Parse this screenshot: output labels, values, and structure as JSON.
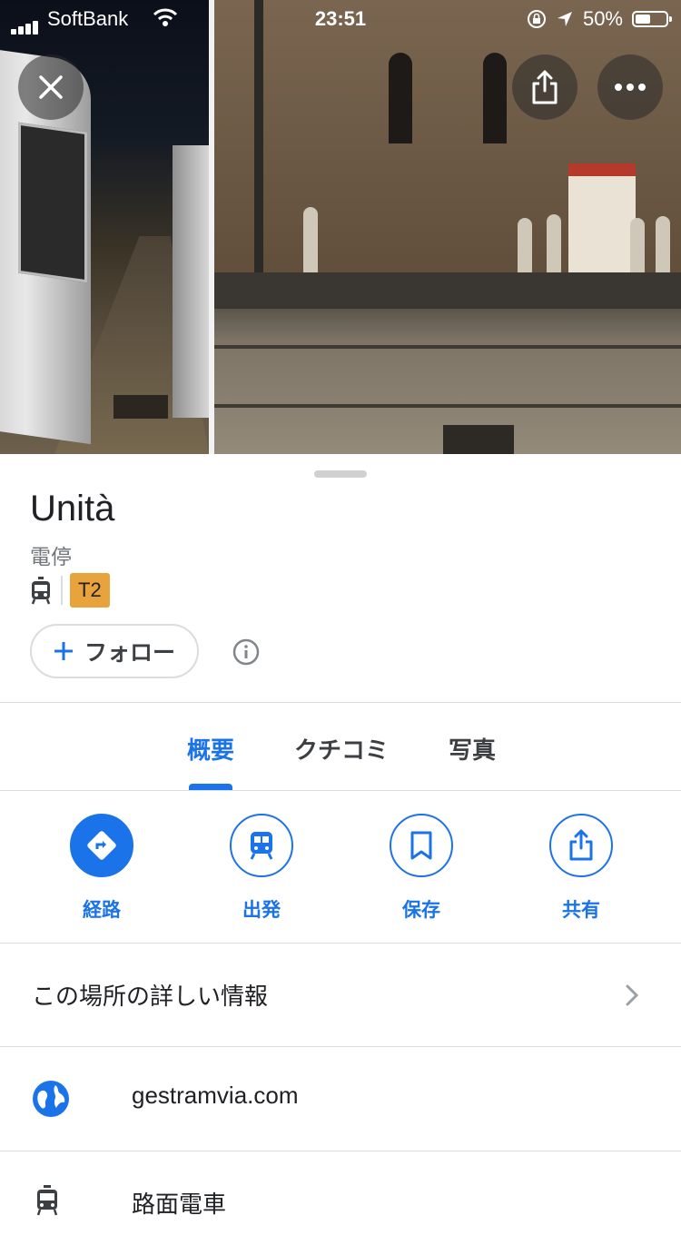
{
  "status_bar": {
    "carrier": "SoftBank",
    "time": "23:51",
    "battery": "50%",
    "battery_level": 0.5
  },
  "place": {
    "name": "Unità",
    "category": "電停",
    "line_badge": "T2",
    "line_badge_color": "#e8a33c"
  },
  "follow_button": {
    "label": "フォロー"
  },
  "tabs": [
    {
      "label": "概要",
      "active": true
    },
    {
      "label": "クチコミ",
      "active": false
    },
    {
      "label": "写真",
      "active": false
    }
  ],
  "actions": [
    {
      "label": "経路",
      "icon": "directions-icon"
    },
    {
      "label": "出発",
      "icon": "transit-icon"
    },
    {
      "label": "保存",
      "icon": "bookmark-icon"
    },
    {
      "label": "共有",
      "icon": "share-icon"
    }
  ],
  "rows": {
    "details": "この場所の詳しい情報",
    "website": "gestramvia.com",
    "transit_type": "路面電車"
  },
  "colors": {
    "accent": "#1a73e8",
    "text_primary": "#202124",
    "text_secondary": "#70757a"
  }
}
